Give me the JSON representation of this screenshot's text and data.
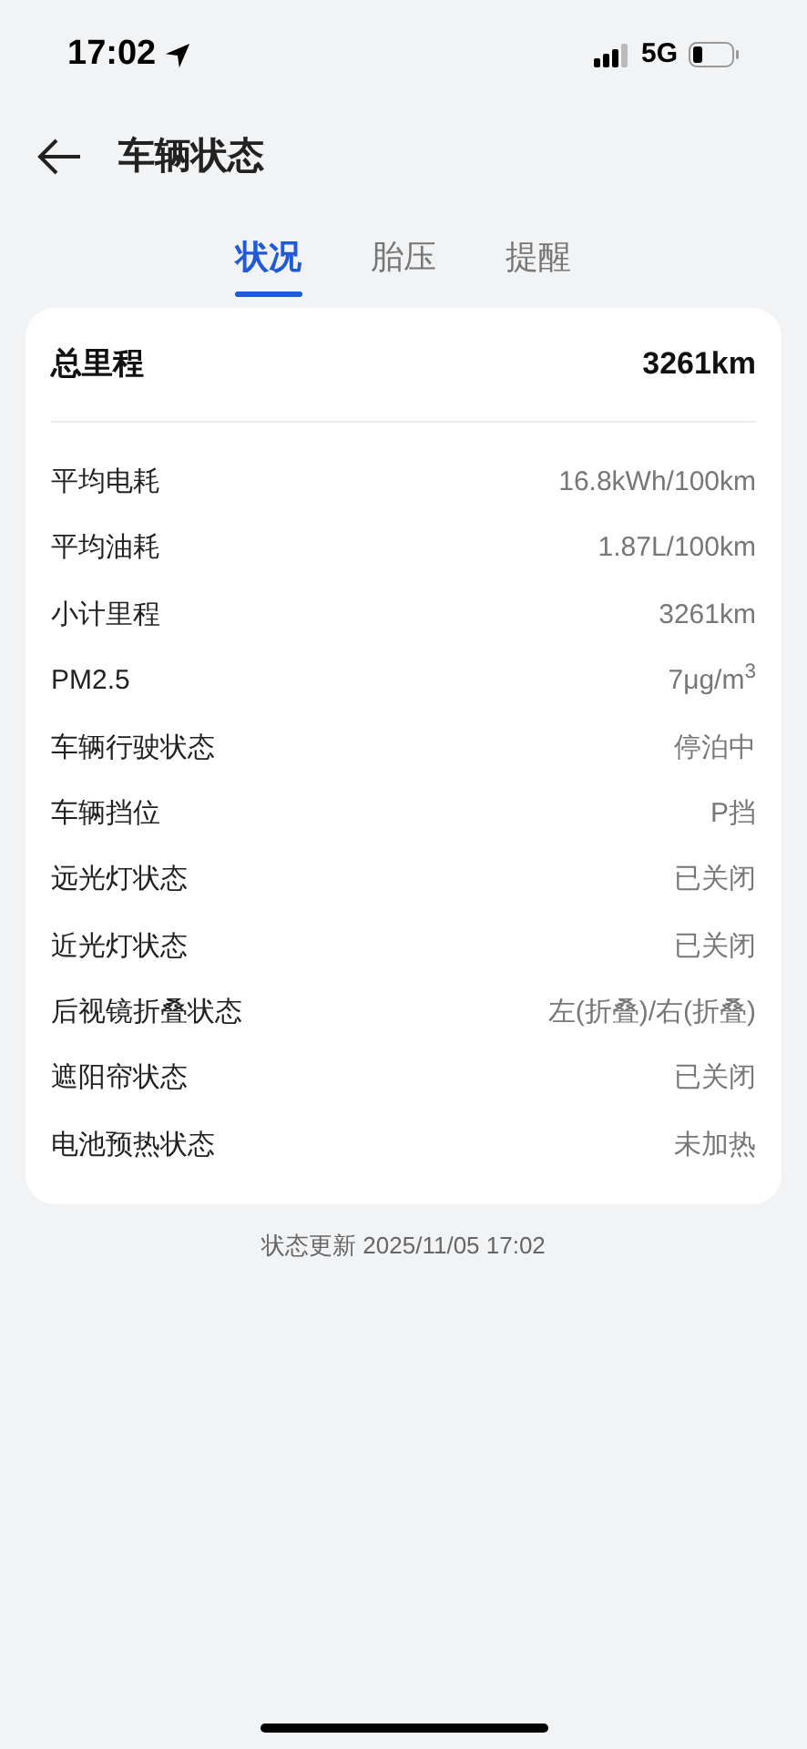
{
  "status_bar": {
    "time": "17:02",
    "network": "5G"
  },
  "header": {
    "title": "车辆状态"
  },
  "tabs": [
    {
      "label": "状况",
      "selected": true
    },
    {
      "label": "胎压",
      "selected": false
    },
    {
      "label": "提醒",
      "selected": false
    }
  ],
  "summary": {
    "label": "总里程",
    "value": "3261km"
  },
  "rows": [
    {
      "label": "平均电耗",
      "value": "16.8kWh/100km"
    },
    {
      "label": "平均油耗",
      "value": "1.87L/100km"
    },
    {
      "label": "小计里程",
      "value": "3261km"
    },
    {
      "label": "PM2.5",
      "value": "7μg/m$^{3}$"
    },
    {
      "label": "车辆行驶状态",
      "value": "停泊中"
    },
    {
      "label": "车辆挡位",
      "value": "P挡"
    },
    {
      "label": "远光灯状态",
      "value": "已关闭"
    },
    {
      "label": "近光灯状态",
      "value": "已关闭"
    },
    {
      "label": "后视镜折叠状态",
      "value": "左(折叠)/右(折叠)"
    },
    {
      "label": "遮阳帘状态",
      "value": "已关闭"
    },
    {
      "label": "电池预热状态",
      "value": "未加热"
    }
  ],
  "footer": "状态更新 2025/11/05 17:02"
}
